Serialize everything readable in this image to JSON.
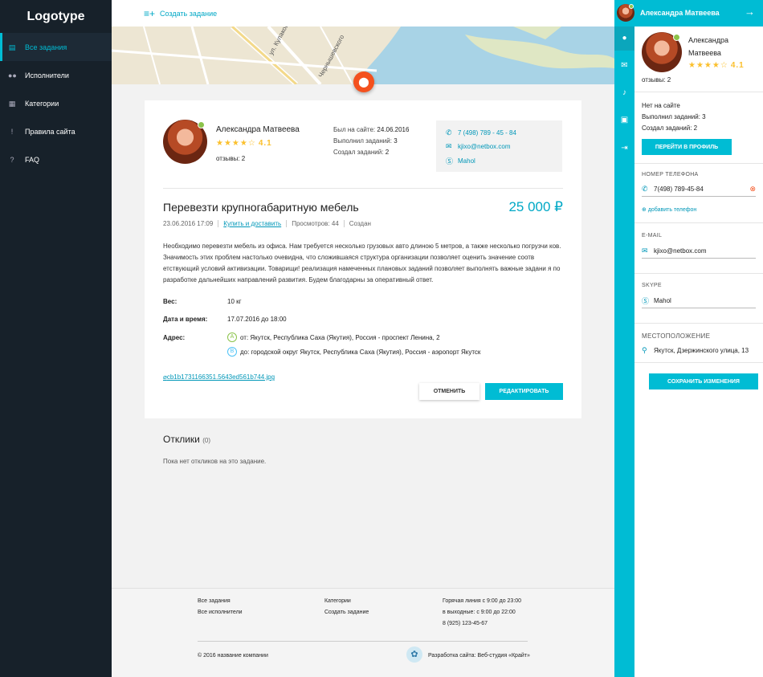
{
  "app": {
    "logo": "Logotype"
  },
  "nav": [
    {
      "label": "Все задания",
      "icon": "tasks-icon",
      "active": true
    },
    {
      "label": "Исполнители",
      "icon": "people-icon",
      "active": false
    },
    {
      "label": "Категории",
      "icon": "grid-icon",
      "active": false
    },
    {
      "label": "Правила сайта",
      "icon": "rules-icon",
      "active": false
    },
    {
      "label": "FAQ",
      "icon": "help-icon",
      "active": false
    }
  ],
  "topbar": {
    "create_label": "Создать задание"
  },
  "map": {
    "street1": "ул. Кулаковского",
    "street2": "Чернышевского"
  },
  "owner": {
    "name": "Александра Матвеева",
    "rating": "4.1",
    "reviews": "отзывы: 2",
    "last_seen_label": "Был на сайте:",
    "last_seen": "24.06.2016",
    "done_label": "Выполнил заданий:",
    "done": "3",
    "created_label": "Создал заданий:",
    "created": "2",
    "phone": "7 (498) 789 - 45 - 84",
    "email": "kjixo@netbox.com",
    "skype": "Mahol"
  },
  "task": {
    "title": "Перевезти крупногабаритную мебель",
    "price": "25 000 ₽",
    "date": "23.06.2016 17:09",
    "category": "Купить и доставить",
    "views": "Просмотров: 44",
    "status": "Создан",
    "description": "Необходимо перевезти мебель из офиса. Нам требуется несколько грузовых авто длиною 5 метров, а также несколько погрузчи ков. Значимость этих проблем настолько очевидна, что сложившаяся структура организации позволяет оценить значение соотв етствующий условий активизации. Товарищи! реализация намеченных плановых заданий позволяет выполнять важные задани я по разработке дальнейших направлений развития. Будем благодарны за оперативный ответ.",
    "weight_label": "Вес:",
    "weight": "10 кг",
    "datetime_label": "Дата и время:",
    "datetime": "17.07.2016 до 18:00",
    "address_label": "Адрес:",
    "from_badge": "A",
    "from": "от: Якутск, Республика Саха (Якутия), Россия - проспект Ленина, 2",
    "to_badge": "B",
    "to": "до: городской округ Якутск, Республика Саха (Якутия), Россия - аэропорт Якутск",
    "attachment": "cb1b1731166351.5643ed561b744.jpg",
    "cancel_label": "ОТМЕНИТЬ",
    "edit_label": "РЕДАКТИРОВАТЬ"
  },
  "responses": {
    "title": "Отклики",
    "count": "(0)",
    "empty": "Пока нет откликов на это задание."
  },
  "footer": {
    "col1": [
      "Все задания",
      "Все исполнители"
    ],
    "col2": [
      "Категории",
      "Создать задание"
    ],
    "col3": [
      "Горячая линия с 9:00 до 23:00",
      "в выходные: с 9:00 до 22:00",
      "8 (925) 123-45-67"
    ],
    "copyright": "© 2016 название компании",
    "dev": "Разработка сайта: Веб-студия «Крайт»"
  },
  "panel": {
    "header_name": "Александра Матвеева",
    "name_line1": "Александра",
    "name_line2": "Матвеева",
    "rating": "4.1",
    "reviews": "отзывы: 2",
    "status": "Нет на сайте",
    "done": "Выполнил заданий: 3",
    "created": "Создал заданий: 2",
    "profile_btn": "ПЕРЕЙТИ В ПРОФИЛЬ",
    "phone_label": "НОМЕР ТЕЛЕФОНА",
    "phone_value": "7(498) 789-45-84",
    "add_phone": "добавить телефон",
    "email_label": "E-MAIL",
    "email_value": "kjixo@netbox.com",
    "skype_label": "SKYPE",
    "skype_value": "Mahol",
    "location_label": "МЕСТОПОЛОЖЕНИЕ",
    "location_value": "Якутск, Дзержинского улица, 13",
    "save_btn": "СОХРАНИТЬ ИЗМЕНЕНИЯ"
  },
  "colors": {
    "accent": "#00bcd4",
    "sidebar": "#17212a",
    "stars": "#fbc02d",
    "pin": "#f4511e",
    "online": "#8bc34a"
  }
}
